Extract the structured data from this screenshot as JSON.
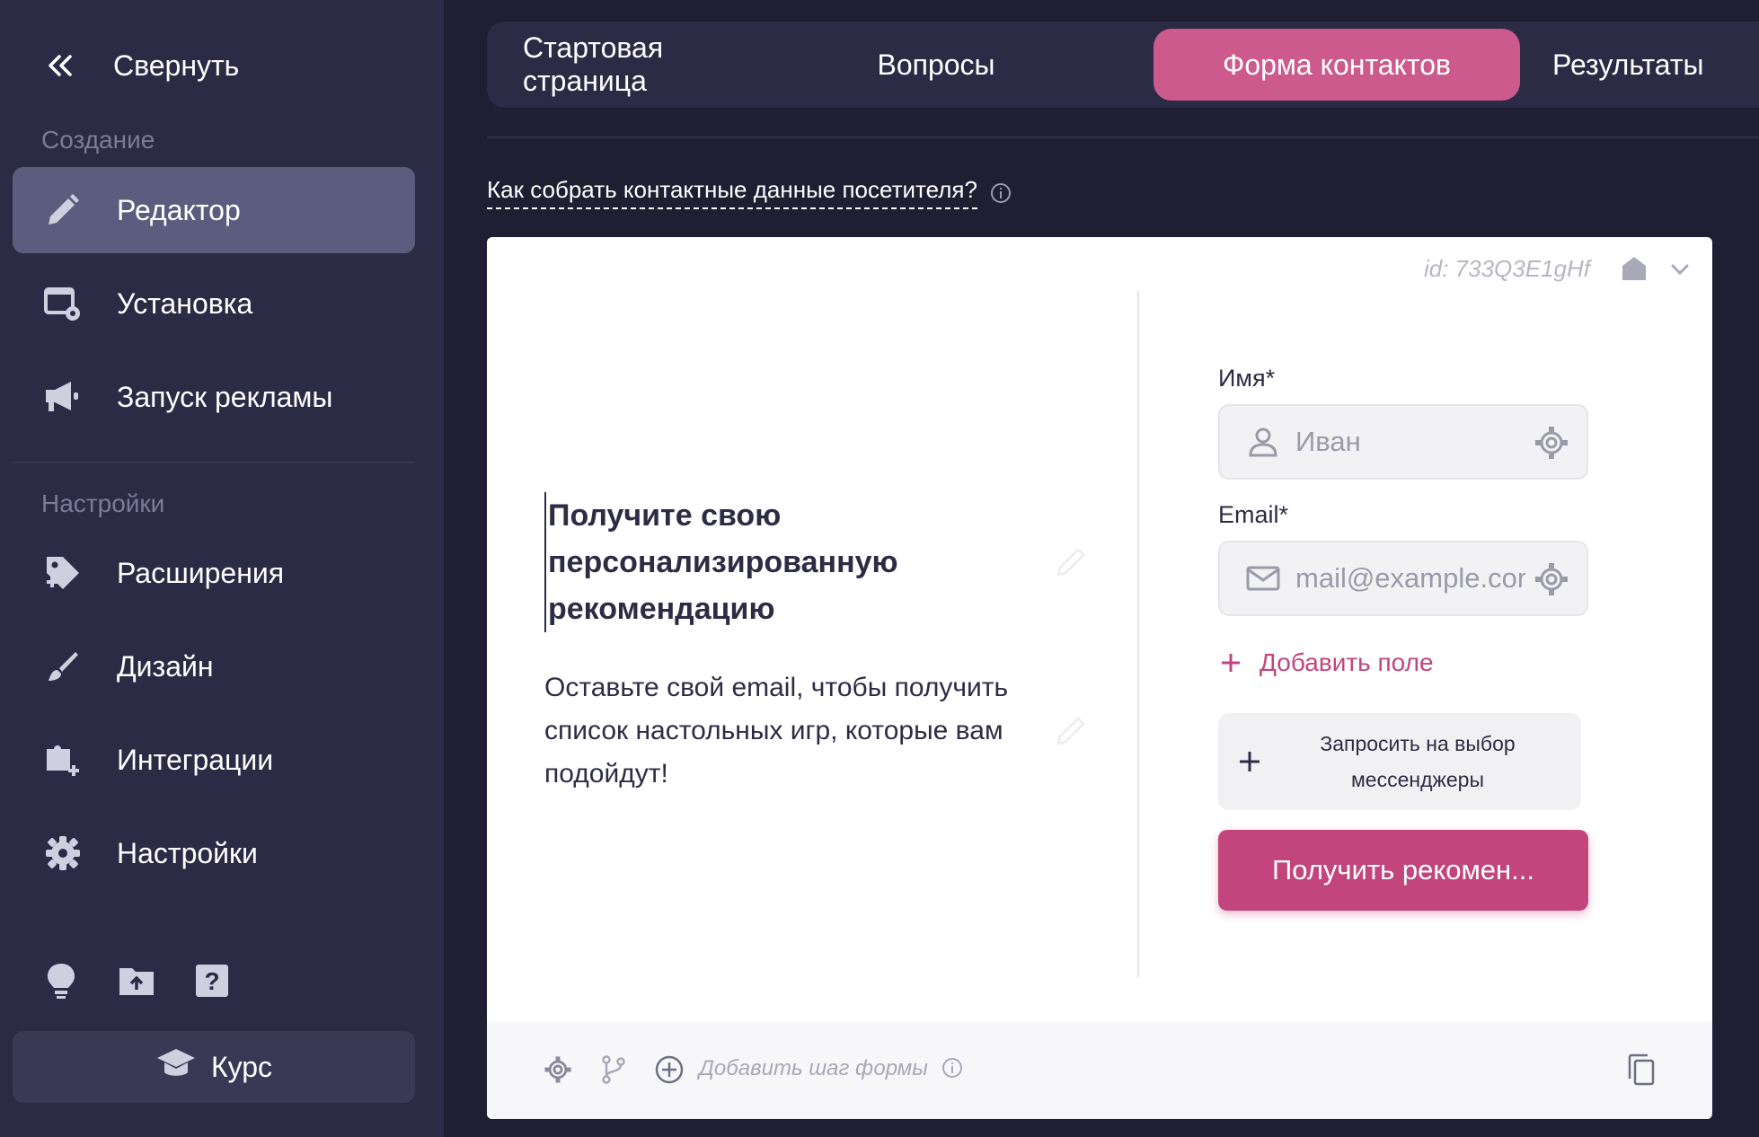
{
  "sidebar": {
    "collapse_label": "Свернуть",
    "section_create": "Создание",
    "section_settings": "Настройки",
    "items": [
      {
        "label": "Редактор",
        "icon": "pencil-icon",
        "active": true
      },
      {
        "label": "Установка",
        "icon": "install-icon"
      },
      {
        "label": "Запуск рекламы",
        "icon": "megaphone-icon"
      },
      {
        "label": "Расширения",
        "icon": "tag-plus-icon"
      },
      {
        "label": "Дизайн",
        "icon": "brush-icon"
      },
      {
        "label": "Интеграции",
        "icon": "puzzle-plus-icon"
      },
      {
        "label": "Настройки",
        "icon": "gear-icon"
      }
    ],
    "bottom_icons": [
      "lightbulb-icon",
      "folder-upload-icon",
      "help-icon"
    ],
    "course_label": "Курс"
  },
  "tabs": [
    {
      "label": "Стартовая страница"
    },
    {
      "label": "Вопросы"
    },
    {
      "label": "Форма контактов",
      "active": true
    },
    {
      "label": "Результаты"
    }
  ],
  "help_link": "Как собрать контактные данные посетителя?",
  "card": {
    "id_text": "id: 733Q3E1gHf",
    "headline": "Получите свою персонализированную рекомендацию",
    "subtext": "Оставьте свой email, чтобы получить список настольных игр, которые вам подойдут!",
    "fields": [
      {
        "label": "Имя*",
        "placeholder": "Иван",
        "icon": "user-icon"
      },
      {
        "label": "Email*",
        "placeholder": "mail@example.com",
        "icon": "mail-icon"
      }
    ],
    "add_field_label": "Добавить поле",
    "messenger_label": "Запросить на выбор мессенджеры",
    "submit_label": "Получить рекомен...",
    "footer_add_step": "Добавить шаг формы"
  },
  "colors": {
    "background": "#1f1e33",
    "sidebar": "#2c2b45",
    "accent_tab": "#cd5a8c",
    "accent_button": "#c2457d"
  }
}
